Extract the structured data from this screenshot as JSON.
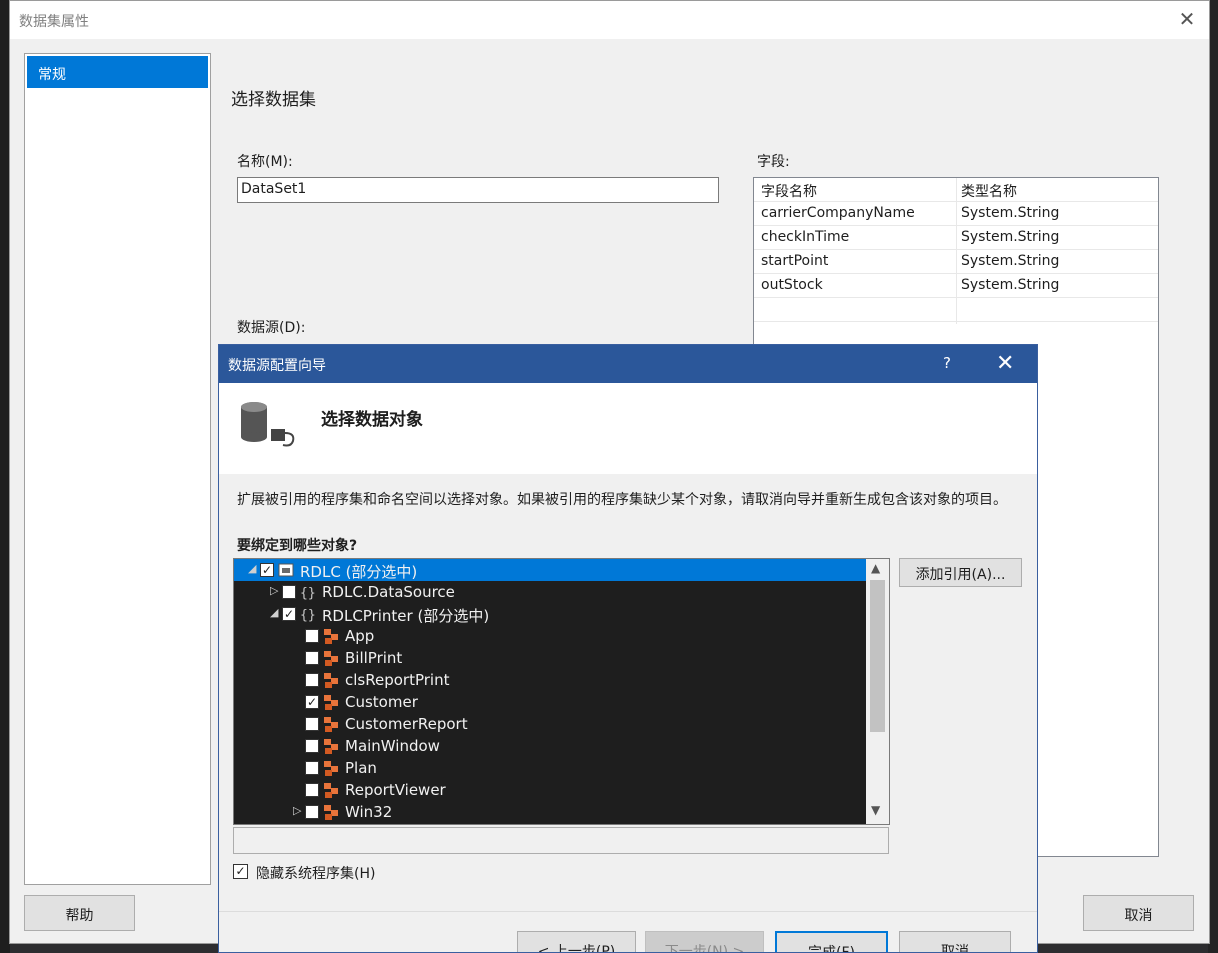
{
  "outer_dialog": {
    "title": "数据集属性",
    "nav_items": [
      "常规"
    ],
    "section_title": "选择数据集",
    "name_label": "名称(M):",
    "name_value": "DataSet1",
    "datasource_label": "数据源(D):",
    "fields_label": "字段:",
    "fields_table": {
      "headers": [
        "字段名称",
        "类型名称"
      ],
      "rows": [
        [
          "carrierCompanyName",
          "System.String"
        ],
        [
          "checkInTime",
          "System.String"
        ],
        [
          "startPoint",
          "System.String"
        ],
        [
          "outStock",
          "System.String"
        ]
      ]
    },
    "help_button": "帮助",
    "cancel_button": "取消"
  },
  "wizard": {
    "title": "数据源配置向导",
    "help_glyph": "?",
    "header_title": "选择数据对象",
    "description": "扩展被引用的程序集和命名空间以选择对象。如果被引用的程序集缺少某个对象，请取消向导并重新生成包含该对象的项目。",
    "question": "要绑定到哪些对象?",
    "tree": [
      {
        "label": "RDLC (部分选中)",
        "level": 0,
        "expand": "expanded",
        "checked": true,
        "icon": "assembly-icon",
        "selected": true
      },
      {
        "label": "RDLC.DataSource",
        "level": 1,
        "expand": "collapsed",
        "checked": false,
        "icon": "namespace-icon",
        "selected": false
      },
      {
        "label": "RDLCPrinter (部分选中)",
        "level": 1,
        "expand": "expanded",
        "checked": true,
        "icon": "namespace-icon",
        "selected": false
      },
      {
        "label": "App",
        "level": 2,
        "expand": "none",
        "checked": false,
        "icon": "class-icon",
        "selected": false
      },
      {
        "label": "BillPrint",
        "level": 2,
        "expand": "none",
        "checked": false,
        "icon": "class-icon",
        "selected": false
      },
      {
        "label": "clsReportPrint",
        "level": 2,
        "expand": "none",
        "checked": false,
        "icon": "class-icon",
        "selected": false
      },
      {
        "label": "Customer",
        "level": 2,
        "expand": "none",
        "checked": true,
        "icon": "class-icon",
        "selected": false
      },
      {
        "label": "CustomerReport",
        "level": 2,
        "expand": "none",
        "checked": false,
        "icon": "class-icon",
        "selected": false
      },
      {
        "label": "MainWindow",
        "level": 2,
        "expand": "none",
        "checked": false,
        "icon": "class-icon",
        "selected": false
      },
      {
        "label": "Plan",
        "level": 2,
        "expand": "none",
        "checked": false,
        "icon": "class-icon",
        "selected": false
      },
      {
        "label": "ReportViewer",
        "level": 2,
        "expand": "none",
        "checked": false,
        "icon": "class-icon",
        "selected": false
      },
      {
        "label": "Win32",
        "level": 2,
        "expand": "collapsed",
        "checked": false,
        "icon": "class-icon",
        "selected": false
      }
    ],
    "add_reference_button": "添加引用(A)...",
    "hide_system_label": "隐藏系统程序集(H)",
    "hide_system_checked": true,
    "buttons": {
      "prev": "< 上一步(P)",
      "next": "下一步(N) >",
      "finish": "完成(F)",
      "cancel": "取消"
    }
  },
  "colors": {
    "selection": "#0078d7",
    "wizard_title_bar": "#2b579a",
    "tree_background": "#1e1e1e",
    "class_icon": "#e8743b"
  }
}
